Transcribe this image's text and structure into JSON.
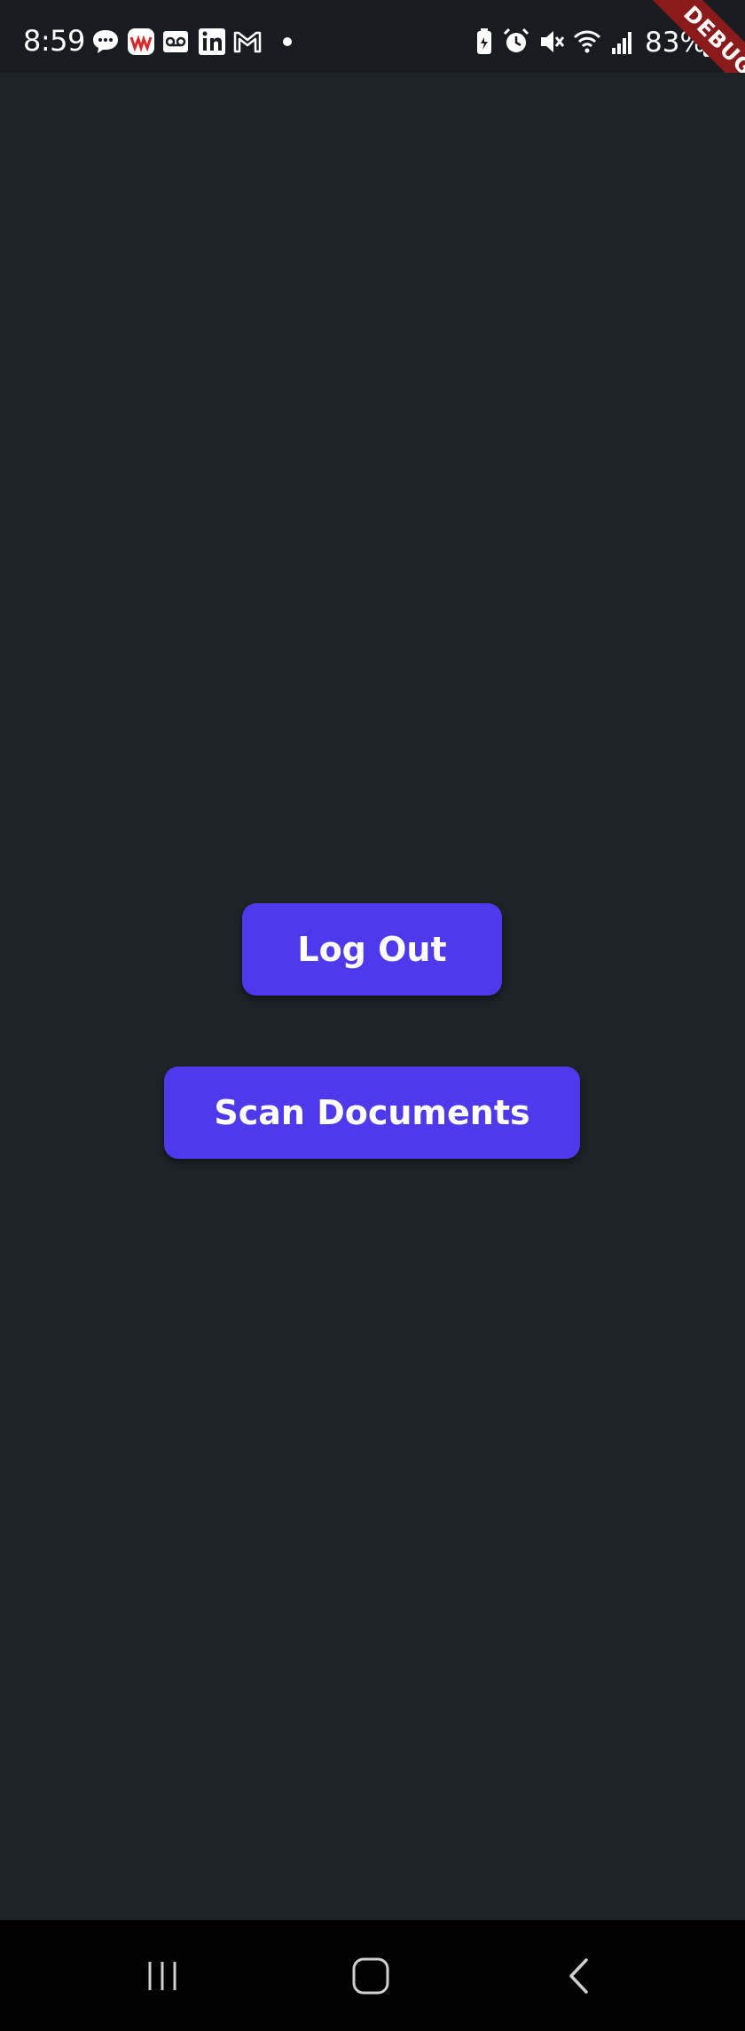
{
  "status_bar": {
    "time": "8:59",
    "battery_percent": "83%",
    "notification_icons": [
      "chat-bubble-icon",
      "news-app-icon",
      "voicemail-icon",
      "linkedin-icon",
      "gmail-icon",
      "more-notifications-dot-icon"
    ],
    "system_icons": [
      "battery-saver-icon",
      "alarm-icon",
      "mute-icon",
      "wifi-icon",
      "signal-icon",
      "battery-icon"
    ]
  },
  "debug_banner": {
    "label": "DEBUG",
    "color": "#8b1a1a"
  },
  "main": {
    "logout_button": "Log Out",
    "scan_button": "Scan Documents",
    "accent_color": "#4f39ed",
    "background_color": "#1e2328"
  },
  "nav_bar": {
    "items": [
      "recent-apps-icon",
      "home-icon",
      "back-icon"
    ]
  }
}
